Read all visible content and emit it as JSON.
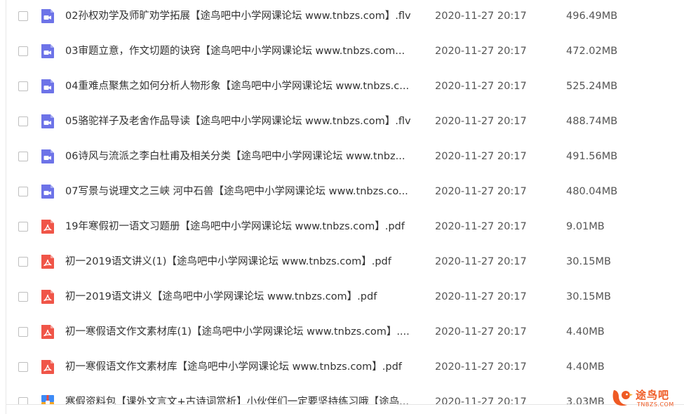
{
  "files": [
    {
      "type": "video",
      "name": "02孙权劝学及师旷劝学拓展【途鸟吧中小学网课论坛 www.tnbzs.com】.flv",
      "date": "2020-11-27 20:17",
      "size": "496.49MB"
    },
    {
      "type": "video",
      "name": "03审题立意，作文切题的诀窍【途鸟吧中小学网课论坛 www.tnbzs.com...",
      "date": "2020-11-27 20:17",
      "size": "472.02MB"
    },
    {
      "type": "video",
      "name": "04重难点聚焦之如何分析人物形象【途鸟吧中小学网课论坛 www.tnbzs.c...",
      "date": "2020-11-27 20:17",
      "size": "525.24MB"
    },
    {
      "type": "video",
      "name": "05骆驼祥子及老舍作品导读【途鸟吧中小学网课论坛 www.tnbzs.com】.flv",
      "date": "2020-11-27 20:17",
      "size": "488.74MB"
    },
    {
      "type": "video",
      "name": "06诗风与流派之李白杜甫及相关分类【途鸟吧中小学网课论坛 www.tnbz...",
      "date": "2020-11-27 20:17",
      "size": "491.56MB"
    },
    {
      "type": "video",
      "name": "07写景与说理文之三峡 河中石兽【途鸟吧中小学网课论坛 www.tnbzs.co...",
      "date": "2020-11-27 20:17",
      "size": "480.04MB"
    },
    {
      "type": "pdf",
      "name": "19年寒假初一语文习题册【途鸟吧中小学网课论坛 www.tnbzs.com】.pdf",
      "date": "2020-11-27 20:17",
      "size": "9.01MB"
    },
    {
      "type": "pdf",
      "name": "初一2019语文讲义(1)【途鸟吧中小学网课论坛 www.tnbzs.com】.pdf",
      "date": "2020-11-27 20:17",
      "size": "30.15MB"
    },
    {
      "type": "pdf",
      "name": "初一2019语文讲义【途鸟吧中小学网课论坛 www.tnbzs.com】.pdf",
      "date": "2020-11-27 20:17",
      "size": "30.15MB"
    },
    {
      "type": "pdf",
      "name": "初一寒假语文作文素材库(1)【途鸟吧中小学网课论坛 www.tnbzs.com】....",
      "date": "2020-11-27 20:17",
      "size": "4.40MB"
    },
    {
      "type": "pdf",
      "name": "初一寒假语文作文素材库【途鸟吧中小学网课论坛 www.tnbzs.com】.pdf",
      "date": "2020-11-27 20:17",
      "size": "4.40MB"
    },
    {
      "type": "archive",
      "name": "寒假资料包【课外文言文+古诗词赏析】小伙伴们一定要坚持练习哦【途鸟...",
      "date": "2020-11-27 20:17",
      "size": "3.03MB"
    }
  ],
  "watermark": {
    "text": "途鸟吧",
    "sub": "TNBZS.COM"
  },
  "colors": {
    "video_icon": "#6d73e8",
    "pdf_icon": "#f05548",
    "archive_icon_top": "#3d8bf7",
    "archive_icon_bottom": "#f5a623",
    "watermark": "#ef5a24"
  },
  "icons": {
    "video": "video-file-icon",
    "pdf": "pdf-file-icon",
    "archive": "archive-file-icon"
  }
}
